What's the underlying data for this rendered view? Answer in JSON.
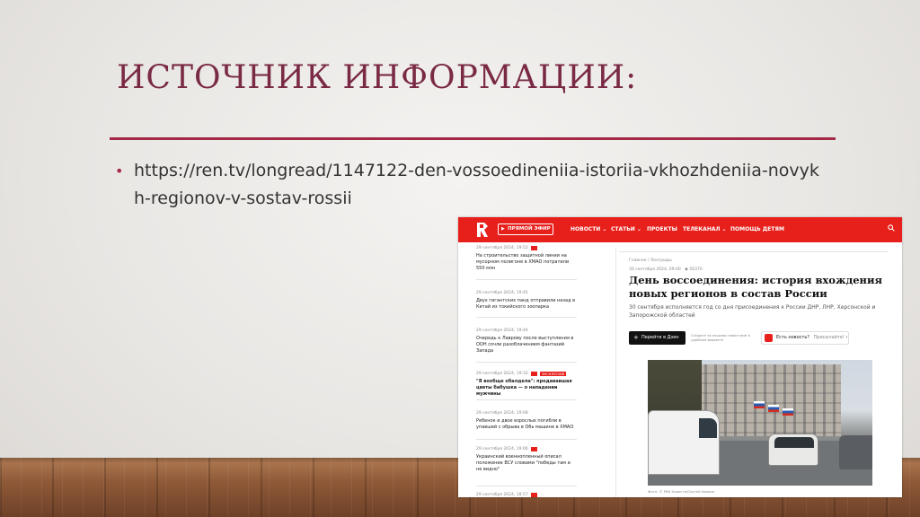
{
  "slide": {
    "title": "ИСТОЧНИК ИНФОРМАЦИИ:",
    "bullet": "https://ren.tv/longread/1147122-den-vossoedineniia-istoriia-vkhozhdeniia-novykh-regionov-v-sostav-rossii"
  },
  "colors": {
    "title": "#7a2a45",
    "rule": "#a32a47",
    "brand_red": "#e8201c"
  },
  "site": {
    "nav": {
      "live": "ПРЯМОЙ ЭФИР",
      "items": [
        "НОВОСТИ ⌄",
        "СТАТЬИ ⌄",
        "ПРОЕКТЫ",
        "ТЕЛЕКАНАЛ ⌄",
        "ПОМОЩЬ ДЕТЯМ"
      ],
      "search_icon": "search-icon"
    },
    "feed": [
      {
        "date": "29 сентября 2024, 19:52",
        "text": "На строительство защитной линии на мусорном полигоне в ХМАО потратили 550 млн"
      },
      {
        "date": "29 сентября 2024, 19:45",
        "text": "Двух гигантских панд отправили назад в Китай из токийского зоопарка"
      },
      {
        "date": "29 сентября 2024, 19:44",
        "text": "Очередь к Лаврову после выступления в ООН сочли разоблачением фантазий Запада"
      },
      {
        "date": "29 сентября 2024, 19:32",
        "tag": "ЭКСКЛЮЗИВ",
        "text": "\"Я вообще обалдела\": продававшая цветы бабушка — о нападении мужчины"
      },
      {
        "date": "29 сентября 2024, 19:08",
        "text": "Ребенок и двое взрослых погибли в упавшей с обрыва в Обь машине в ХМАО"
      },
      {
        "date": "29 сентября 2024, 19:06",
        "text": "Украинский военнопленный описал положение ВСУ словами \"победы там и не видно\""
      },
      {
        "date": "29 сентября 2024, 18:57",
        "text": ""
      }
    ],
    "article": {
      "crumbs": "Главная / Лонгриды",
      "date": "30 сентября 2024, 09:00",
      "views": "56370",
      "headline": "День воссоединения: история вхождения новых регионов в состав России",
      "lead": "30 сентября исполняется год со дня присоединения к России ДНР, ЛНР, Херсонской и Запорожской областей",
      "dzen_button": "Перейти в Дзен",
      "dzen_note": "Следите за нашими новостями в удобном формате",
      "news_prompt": "Есть новость?",
      "news_send": "Присылайте!",
      "caption": "Фото: © РИА Новости/Сергей Аверин"
    }
  }
}
